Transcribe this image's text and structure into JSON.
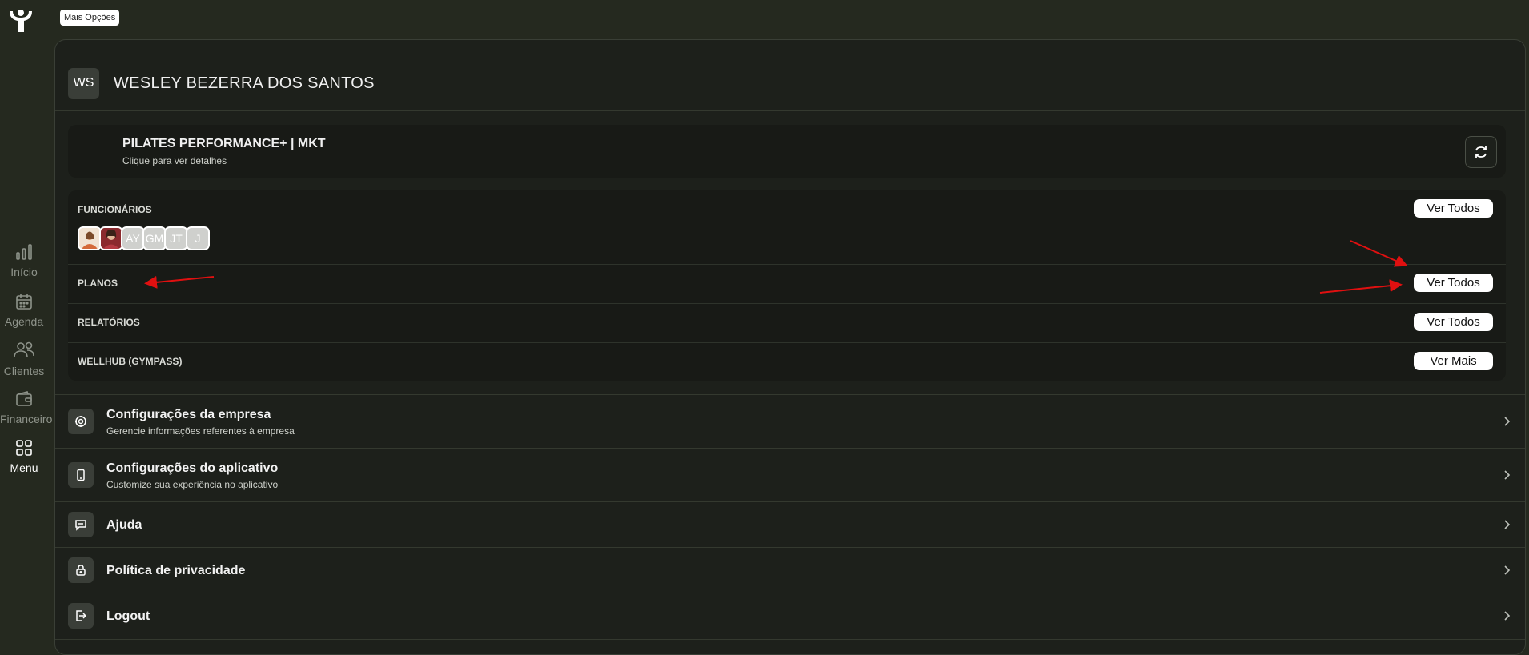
{
  "top_badge": "Mais Opções",
  "nav": [
    {
      "label": "Início",
      "icon": "bar-chart-icon"
    },
    {
      "label": "Agenda",
      "icon": "calendar-icon"
    },
    {
      "label": "Clientes",
      "icon": "users-icon"
    },
    {
      "label": "Financeiro",
      "icon": "wallet-icon"
    },
    {
      "label": "Menu",
      "icon": "grid-icon",
      "active": true
    }
  ],
  "profile": {
    "initials": "WS",
    "name": "WESLEY BEZERRA DOS SANTOS"
  },
  "company": {
    "name": "PILATES PERFORMANCE+ | MKT",
    "subtitle": "Clique para ver detalhes"
  },
  "sections": [
    {
      "label": "FUNCIONÁRIOS",
      "action": "Ver Todos"
    },
    {
      "label": "PLANOS",
      "action": "Ver Todos"
    },
    {
      "label": "RELATÓRIOS",
      "action": "Ver Todos"
    },
    {
      "label": "WELLHUB (GYMPASS)",
      "action": "Ver Mais"
    }
  ],
  "employee_avatars": [
    "",
    "",
    "AY",
    "GM",
    "JT",
    "J"
  ],
  "menu_items": [
    {
      "title": "Configurações da empresa",
      "subtitle": "Gerencie informações referentes à empresa",
      "icon": "gear-icon"
    },
    {
      "title": "Configurações do aplicativo",
      "subtitle": "Customize sua experiência no aplicativo",
      "icon": "phone-icon"
    },
    {
      "title": "Ajuda",
      "subtitle": "",
      "icon": "chat-icon"
    },
    {
      "title": "Política de privacidade",
      "subtitle": "",
      "icon": "lock-icon"
    },
    {
      "title": "Logout",
      "subtitle": "",
      "icon": "logout-icon"
    }
  ],
  "colors": {
    "background": "#25291f",
    "panel": "#1d201b",
    "card": "#181a16",
    "annotation_arrow": "#e01010"
  }
}
